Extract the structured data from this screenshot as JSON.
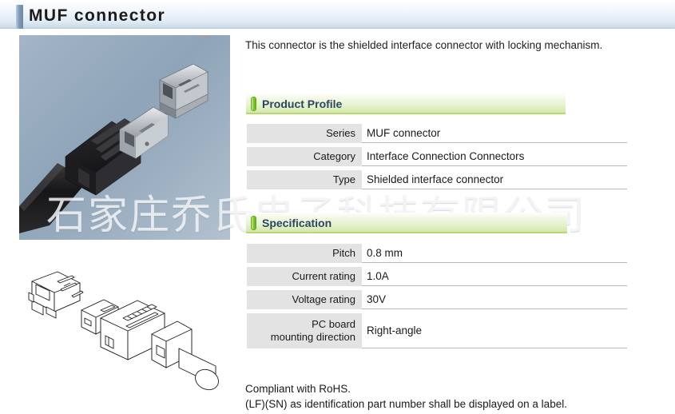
{
  "header": {
    "title": "MUF connector",
    "accent_color": "#7e9bb5"
  },
  "intro": {
    "text": "This connector is the shielded interface connector with locking mechanism."
  },
  "watermark": {
    "text": "石家庄乔氏电子科技有限公司"
  },
  "images": {
    "photo_alt": "MUF connector plug and receptacle photograph",
    "drawing_alt": "MUF connector assembly line drawing",
    "photo_background": "#93a8bb"
  },
  "sections": [
    {
      "id": "product-profile",
      "label": "Product Profile",
      "accent_color": "#8dcf3f",
      "rows": [
        {
          "label": "Series",
          "value": "MUF connector"
        },
        {
          "label": "Category",
          "value": "Interface Connection Connectors"
        },
        {
          "label": "Type",
          "value": "Shielded interface connector"
        }
      ]
    },
    {
      "id": "specification",
      "label": "Specification",
      "accent_color": "#8dcf3f",
      "rows": [
        {
          "label": "Pitch",
          "value": "0.8 mm"
        },
        {
          "label": "Current rating",
          "value": "1.0A"
        },
        {
          "label": "Voltage rating",
          "value": "30V"
        },
        {
          "label": "PC board",
          "label2": "mounting direction",
          "value": "Right-angle"
        }
      ]
    }
  ],
  "footer": {
    "line1": "Compliant with RoHS.",
    "line2": "(LF)(SN) as identification part number shall be displayed on a label."
  }
}
